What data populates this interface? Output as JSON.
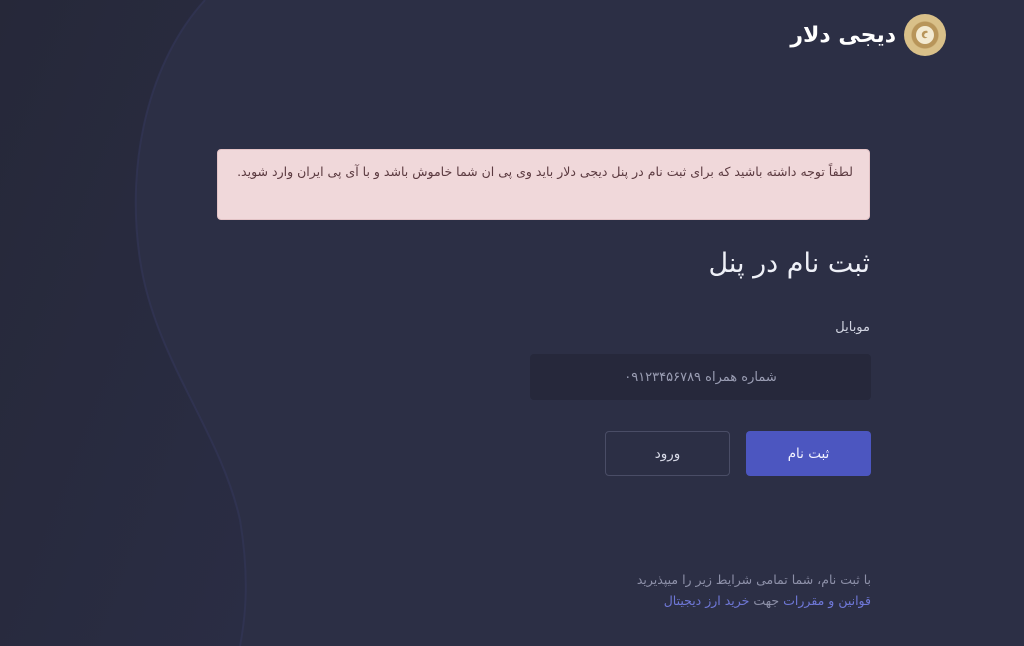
{
  "brand": {
    "name": "دیجی دلار"
  },
  "notice": {
    "text": "لطفاً توجه داشته باشید که برای ثبت نام در پنل دیجی دلار باید وی پی ان شما خاموش باشد و با آی پی ایران وارد شوید."
  },
  "form": {
    "title": "ثبت نام در پنل",
    "mobile_label": "موبایل",
    "mobile_placeholder": "شماره همراه ۰۹۱۲۳۴۵۶۷۸۹",
    "register_label": "ثبت نام",
    "login_label": "ورود"
  },
  "footer": {
    "line1": "با ثبت نام، شما تمامی شرایط زیر را میپذیرید",
    "terms_link": "قوانین و مقررات",
    "middle": "جهت",
    "buy_link": "خرید ارز دیجیتال"
  },
  "colors": {
    "background": "#2c2f45",
    "accent": "#4c56c0",
    "notice_bg": "#f0d8da",
    "link": "#6f78d8",
    "logo_gold": "#d9c089"
  },
  "icons": {
    "logo": "coin-logo-icon"
  }
}
